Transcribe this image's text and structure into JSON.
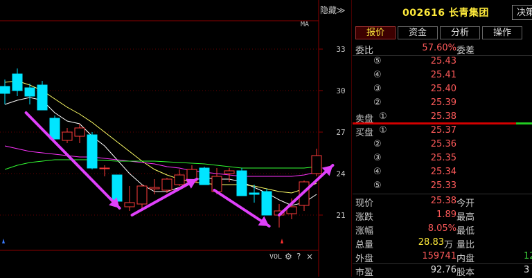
{
  "chart": {
    "hide_button": "隐藏≫",
    "ma_label": "MA",
    "y_ticks": [
      "33",
      "30",
      "27",
      "24",
      "21"
    ],
    "vol_label": "VOL",
    "vol_icons": [
      "⚙",
      "?",
      "×"
    ],
    "colors": {
      "up": "#ff3c3c",
      "down": "#00e5ff",
      "ma5": "#ffffff",
      "ma10": "#ffff66",
      "ma20": "#ff33ff",
      "ma60": "#33ff33",
      "arrow": "#e040fb"
    }
  },
  "chart_data": {
    "type": "candlestick",
    "y_ticks": [
      33,
      30,
      27,
      24,
      21
    ],
    "ylim": [
      19.5,
      34.5
    ],
    "candles": [
      {
        "o": 30.3,
        "h": 30.8,
        "l": 29.0,
        "c": 29.8
      },
      {
        "o": 31.2,
        "h": 31.6,
        "l": 29.6,
        "c": 30.0
      },
      {
        "o": 30.2,
        "h": 30.5,
        "l": 29.0,
        "c": 29.6
      },
      {
        "o": 30.4,
        "h": 30.7,
        "l": 28.6,
        "c": 28.6
      },
      {
        "o": 28.0,
        "h": 28.2,
        "l": 26.5,
        "c": 26.5
      },
      {
        "o": 26.4,
        "h": 27.3,
        "l": 26.2,
        "c": 27.0
      },
      {
        "o": 26.7,
        "h": 27.6,
        "l": 26.2,
        "c": 27.3
      },
      {
        "o": 26.8,
        "h": 27.0,
        "l": 24.3,
        "c": 24.4
      },
      {
        "o": 24.4,
        "h": 24.6,
        "l": 23.8,
        "c": 24.4
      },
      {
        "o": 23.9,
        "h": 23.9,
        "l": 21.8,
        "c": 22.0
      },
      {
        "o": 21.6,
        "h": 23.1,
        "l": 21.3,
        "c": 21.9
      },
      {
        "o": 21.8,
        "h": 23.2,
        "l": 21.3,
        "c": 23.1
      },
      {
        "o": 22.9,
        "h": 23.6,
        "l": 22.5,
        "c": 23.0
      },
      {
        "o": 22.8,
        "h": 23.7,
        "l": 22.6,
        "c": 23.6
      },
      {
        "o": 23.2,
        "h": 24.3,
        "l": 23.1,
        "c": 23.9
      },
      {
        "o": 23.4,
        "h": 24.6,
        "l": 23.3,
        "c": 24.3
      },
      {
        "o": 24.4,
        "h": 24.5,
        "l": 23.2,
        "c": 23.2
      },
      {
        "o": 22.7,
        "h": 24.4,
        "l": 22.5,
        "c": 23.8
      },
      {
        "o": 24.0,
        "h": 24.4,
        "l": 23.4,
        "c": 24.2
      },
      {
        "o": 24.2,
        "h": 24.4,
        "l": 22.4,
        "c": 22.4
      },
      {
        "o": 22.6,
        "h": 23.2,
        "l": 21.9,
        "c": 22.5
      },
      {
        "o": 22.7,
        "h": 22.9,
        "l": 21.0,
        "c": 21.0
      },
      {
        "o": 21.0,
        "h": 21.8,
        "l": 20.1,
        "c": 21.3
      },
      {
        "o": 21.1,
        "h": 22.2,
        "l": 20.7,
        "c": 21.6
      },
      {
        "o": 21.7,
        "h": 23.5,
        "l": 21.3,
        "c": 23.4
      },
      {
        "o": 24.0,
        "h": 25.8,
        "l": 23.8,
        "c": 25.3
      }
    ],
    "series": [
      {
        "values": [
          29.0,
          29.3,
          29.5,
          29.3,
          28.4,
          27.8,
          27.6,
          26.7,
          26.0,
          25.0,
          24.0,
          23.2,
          22.7,
          22.7,
          23.0,
          23.5,
          23.7,
          23.6,
          23.6,
          23.4,
          23.0,
          22.6,
          22.1,
          21.7,
          21.9,
          22.5
        ]
      },
      {
        "values": [
          30.6,
          30.7,
          30.4,
          30.0,
          29.4,
          28.8,
          28.3,
          27.7,
          27.0,
          26.3,
          25.6,
          24.9,
          24.3,
          23.9,
          23.6,
          23.4,
          23.3,
          23.2,
          23.2,
          23.2,
          23.1,
          22.9,
          22.7,
          22.6,
          22.9,
          23.3
        ]
      },
      {
        "values": [
          26.0,
          25.8,
          25.6,
          25.5,
          25.4,
          25.3,
          25.2,
          25.2,
          25.1,
          25.0,
          24.9,
          24.8,
          24.7,
          24.5,
          24.4,
          24.2,
          24.1,
          24.0,
          23.9,
          23.8,
          23.8,
          23.8,
          23.8,
          23.8,
          23.9,
          24.1
        ]
      },
      {
        "values": [
          24.3,
          24.6,
          24.8,
          24.9,
          25.0,
          25.0,
          25.0,
          25.0,
          24.95,
          24.9,
          24.9,
          24.9,
          24.9,
          24.85,
          24.8,
          24.75,
          24.7,
          24.6,
          24.5,
          24.4,
          24.4,
          24.4,
          24.4,
          24.4,
          24.4,
          24.5
        ]
      }
    ],
    "arrows": [
      {
        "from": [
          1.7,
          28.4
        ],
        "to": [
          9.2,
          21.5
        ]
      },
      {
        "from": [
          10.2,
          21.0
        ],
        "to": [
          15.4,
          23.6
        ]
      },
      {
        "from": [
          16.8,
          22.8
        ],
        "to": [
          21.2,
          20.2
        ]
      },
      {
        "from": [
          22.0,
          21.0
        ],
        "to": [
          26.3,
          24.6
        ]
      }
    ]
  },
  "panel": {
    "title": "002616 长青集团",
    "jue_button": "决策",
    "tabs": [
      "报价",
      "资金",
      "分析",
      "操作"
    ],
    "weibi": {
      "label": "委比",
      "value": "57.60%",
      "label2": "委差"
    },
    "asks": [
      {
        "level": "⑤",
        "price": "25.43"
      },
      {
        "level": "④",
        "price": "25.41"
      },
      {
        "level": "③",
        "price": "25.40"
      },
      {
        "level": "②",
        "price": "25.39"
      },
      {
        "label": "卖盘",
        "level": "①",
        "price": "25.38"
      }
    ],
    "bids": [
      {
        "label": "买盘",
        "level": "①",
        "price": "25.37"
      },
      {
        "level": "②",
        "price": "25.36"
      },
      {
        "level": "③",
        "price": "25.35"
      },
      {
        "level": "④",
        "price": "25.34"
      },
      {
        "level": "⑤",
        "price": "25.33"
      }
    ],
    "stats": [
      {
        "label": "现价",
        "value": "25.38",
        "label2": "今开",
        "value2": ""
      },
      {
        "label": "涨跌",
        "value": "1.89",
        "label2": "最高",
        "value2": ""
      },
      {
        "label": "涨幅",
        "value": "8.05%",
        "label2": "最低",
        "value2": ""
      },
      {
        "label": "总量",
        "value": "28.83",
        "unit": "万",
        "label2": "量比",
        "value2": ""
      },
      {
        "label": "外盘",
        "value": "159741",
        "label2": "内盘",
        "value2": "12"
      },
      {
        "label": "市盈",
        "value": "92.76",
        "label2": "股本",
        "value2": "3"
      }
    ]
  }
}
